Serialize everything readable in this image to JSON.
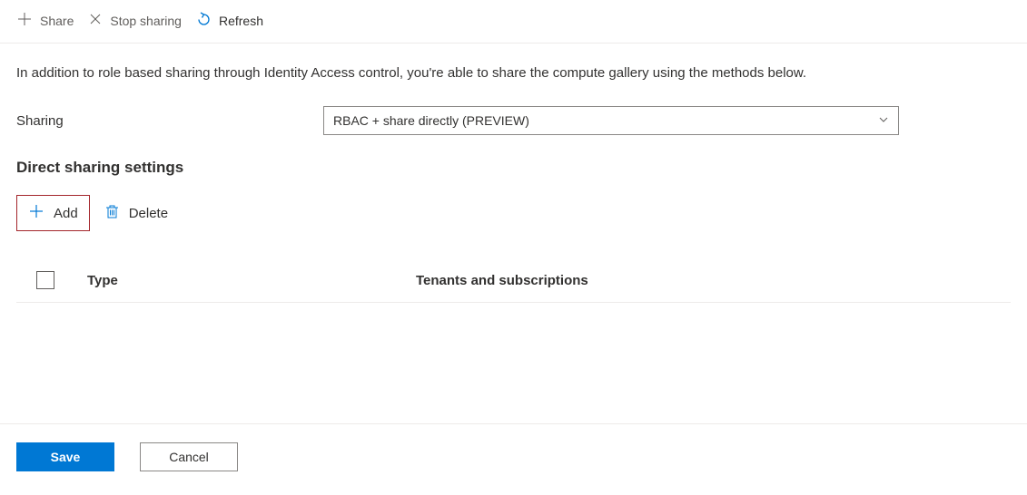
{
  "toolbar": {
    "share_label": "Share",
    "stop_sharing_label": "Stop sharing",
    "refresh_label": "Refresh"
  },
  "description": "In addition to role based sharing through Identity Access control, you're able to share the compute gallery using the methods below.",
  "sharing_field": {
    "label": "Sharing",
    "value": "RBAC + share directly (PREVIEW)"
  },
  "section_title": "Direct sharing settings",
  "actions": {
    "add_label": "Add",
    "delete_label": "Delete"
  },
  "table": {
    "col_type": "Type",
    "col_tenants": "Tenants and subscriptions"
  },
  "footer": {
    "save_label": "Save",
    "cancel_label": "Cancel"
  }
}
